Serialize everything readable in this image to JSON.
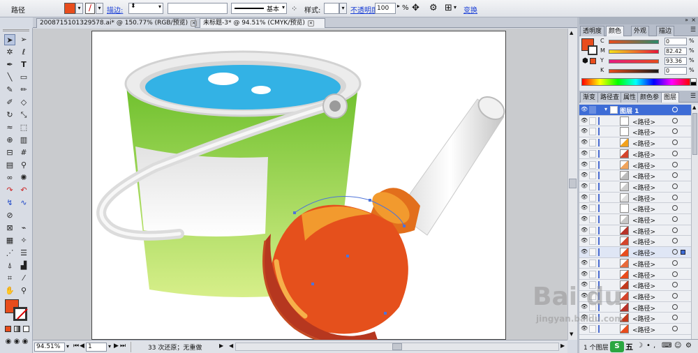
{
  "control_bar": {
    "object_type": "路径",
    "fill_color": "#e84c1c",
    "stroke_label": "描边:",
    "stroke_style_label": "基本",
    "style_label": "样式:",
    "opacity_label": "不透明度:",
    "opacity_value": "100",
    "opacity_unit": "%",
    "transform_label": "变换"
  },
  "doc_tabs": [
    {
      "label": "20087151013295​78.ai* @ 150.77% (RGB/预览)",
      "active": false
    },
    {
      "label": "未标题-3* @ 94.51% (CMYK/预览)",
      "active": true
    }
  ],
  "status_bar": {
    "zoom": "94.51%",
    "page": "1",
    "undo_text": "33 次还原；无重做"
  },
  "color_panel": {
    "tabs": [
      "透明度",
      "颜色",
      "外观",
      "描边"
    ],
    "active_tab": "颜色",
    "fill_color": "#e84c1c",
    "channels": [
      {
        "label": "C",
        "value": "0"
      },
      {
        "label": "M",
        "value": "82.42"
      },
      {
        "label": "Y",
        "value": "93.36"
      },
      {
        "label": "K",
        "value": "0"
      }
    ],
    "unit": "%"
  },
  "layers_panel": {
    "tabs": [
      "渐变",
      "路径查",
      "属性",
      "颜色参",
      "图层"
    ],
    "active_tab": "图层",
    "layer_name": "图层 1",
    "rows": [
      {
        "name": "<路径>",
        "color": "#ffffff"
      },
      {
        "name": "<路径>",
        "color": "#ffffff"
      },
      {
        "name": "<路径>",
        "color": "#f3a21b"
      },
      {
        "name": "<路径>",
        "color": "#d4452c"
      },
      {
        "name": "<路径>",
        "color": "#f0a35a"
      },
      {
        "name": "<路径>",
        "color": "#bbbbbb"
      },
      {
        "name": "<路径>",
        "color": "#cccccc"
      },
      {
        "name": "<路径>",
        "color": "#dddddd"
      },
      {
        "name": "<路径>",
        "color": "#ffffff"
      },
      {
        "name": "<路径>",
        "color": "#c7c7c7"
      },
      {
        "name": "<路径>",
        "color": "#b7332a"
      },
      {
        "name": "<路径>",
        "color": "#d4452c"
      },
      {
        "name": "<路径>",
        "color": "#e84c1c"
      },
      {
        "name": "<路径>",
        "color": "#e86a3a"
      },
      {
        "name": "<路径>",
        "color": "#e84c1c"
      },
      {
        "name": "<路径>",
        "color": "#c13a1c"
      },
      {
        "name": "<路径>",
        "color": "#d4452c"
      },
      {
        "name": "<路径>",
        "color": "#b7332a"
      },
      {
        "name": "<路径>",
        "color": "#c13a1c"
      },
      {
        "name": "<路径>",
        "color": "#e84c1c"
      }
    ],
    "footer_text": "1 个图层"
  },
  "watermark": {
    "brand": "Bai du",
    "sub": "jingyan.baidu.com"
  }
}
